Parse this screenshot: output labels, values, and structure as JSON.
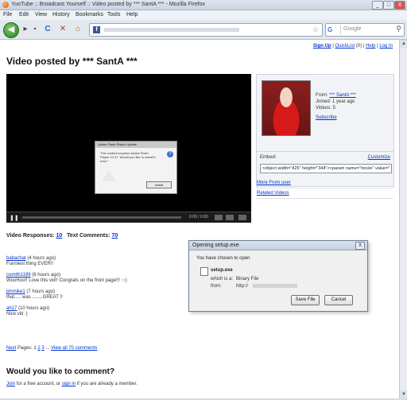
{
  "window": {
    "title": "YuoTube :: Broadcast Yourself :: Video posted by *** SantA *** - Mozilla Firefox",
    "minimize": "_",
    "maximize": "□",
    "close": "X"
  },
  "menu": [
    "File",
    "Edit",
    "View",
    "History",
    "Bookmarks",
    "Tools",
    "Help"
  ],
  "nav": {
    "back": "◀",
    "reload": "C",
    "stop": "✕",
    "home": "⌂",
    "favicon": "f",
    "search_engine": "G",
    "search_placeholder": "Google",
    "star": "☆",
    "search_go": "⚲"
  },
  "page": {
    "top_links": {
      "signup": "Sign Up",
      "quicklist": "QuickList",
      "quicklist_count": "(0)",
      "help": "Help",
      "login": "Log In",
      "sep": "|"
    },
    "title": "Video posted by *** SantA ***",
    "player": {
      "play": "❚❚",
      "time": "0:00 / 0:00"
    },
    "flash_dialog": {
      "title": "Adobe Flash Player Update",
      "message": "This content requires Adobe Flash Player 10.37. Would you like to install it now?",
      "button": "Install"
    },
    "uploader": {
      "from_label": "From:",
      "from_value": "*** SantA ***",
      "joined": "Joined: 1 year ago",
      "videos": "Videos: 5",
      "subscribe": "Subscribe",
      "embed_label": "Embed:",
      "customize": "Customize",
      "embed_code": "<object width=\"425\" height=\"344\"><param name=\"movie\" value=\""
    },
    "side_links": [
      "More From user",
      "Related Videos"
    ],
    "responses": {
      "video_label": "Video Responses:",
      "video_count": "10",
      "text_label": "Text Comments:",
      "text_count": "70"
    },
    "comments": [
      {
        "user": "babachat",
        "time": "(4 hours ago)",
        "text": "Funniest thing EVER!!"
      },
      {
        "user": "comith1199",
        "time": "(6 hours ago)",
        "text": "WooHoo!! Love this vid!! Congrats on the front page!!! :~)"
      },
      {
        "user": "jimmike1",
        "time": "(7 hours ago)",
        "text": "that..... was ........GREAT !!"
      },
      {
        "user": "ah17",
        "time": "(10 hours ago)",
        "text": "Nice vid :)"
      }
    ],
    "pager": {
      "next": "Next",
      "pages_label": "Pages:",
      "p1": "1",
      "p2": "2",
      "p3": "3",
      "dots": "...",
      "view_all": "View all 70 comments"
    },
    "comment_heading": "Would you like to comment?",
    "join": {
      "join_link": "Join",
      "middle": "for a free account, or",
      "signin_link": "sign in",
      "end": "if you are already a member."
    }
  },
  "download_dialog": {
    "title": "Opening setup.exe",
    "close": "X",
    "intro": "You have chosen to open",
    "filename": "setup.exe",
    "which_is_label": "which is a:",
    "which_is_value": "Binary File",
    "from_label": "from:",
    "from_value": "http://",
    "save_button": "Save File",
    "cancel_button": "Cancel"
  },
  "colors": {
    "link": "#0033cc",
    "page_bg": "#ffffff",
    "chrome": "#e3e8ef"
  }
}
